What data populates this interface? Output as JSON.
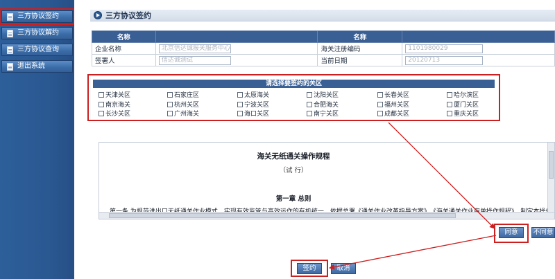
{
  "sidebar": {
    "items": [
      {
        "label": "三方协议签约"
      },
      {
        "label": "三方协议解约"
      },
      {
        "label": "三方协议查询"
      },
      {
        "label": "退出系统"
      }
    ]
  },
  "page": {
    "title": "三方协议签约"
  },
  "info_table": {
    "col_header_left": "名称",
    "col_header_right": "名称",
    "enterprise_label": "企业名称",
    "enterprise_value": "北京信达诚报关服务中心",
    "customs_code_label": "海关注册编码",
    "customs_code_value": "1101980029",
    "signer_label": "签署人",
    "signer_value": "信达诚测试",
    "date_label": "当前日期",
    "date_value": "20120713"
  },
  "customs_select": {
    "header": "请选择要签约的关区",
    "options": [
      "天津关区",
      "石家庄区",
      "太原海关",
      "沈阳关区",
      "长春关区",
      "哈尔滨区",
      "南京海关",
      "杭州关区",
      "宁波关区",
      "合肥海关",
      "福州关区",
      "厦门关区",
      "长沙关区",
      "广州海关",
      "海口关区",
      "南宁关区",
      "成都关区",
      "重庆关区"
    ]
  },
  "procedure": {
    "title": "海关无纸通关操作规程",
    "subtitle": "（试  行）",
    "chapter": "第一章  总则",
    "article_text": "第一条  为规范进出口无纸通关作业模式，实现有效监管与高效运作的有机统一，依据总署《通关作业改革指导方案》、《海关通关作业审单操作规程》，制定本操作规程。    第"
  },
  "buttons": {
    "agree": "同意",
    "disagree": "不同意",
    "sign": "签约",
    "cancel": "取消"
  },
  "colors": {
    "sidebar_bg": "#2d5f9a",
    "header_bg": "#3a5f95",
    "highlight": "#cc1f1f"
  }
}
